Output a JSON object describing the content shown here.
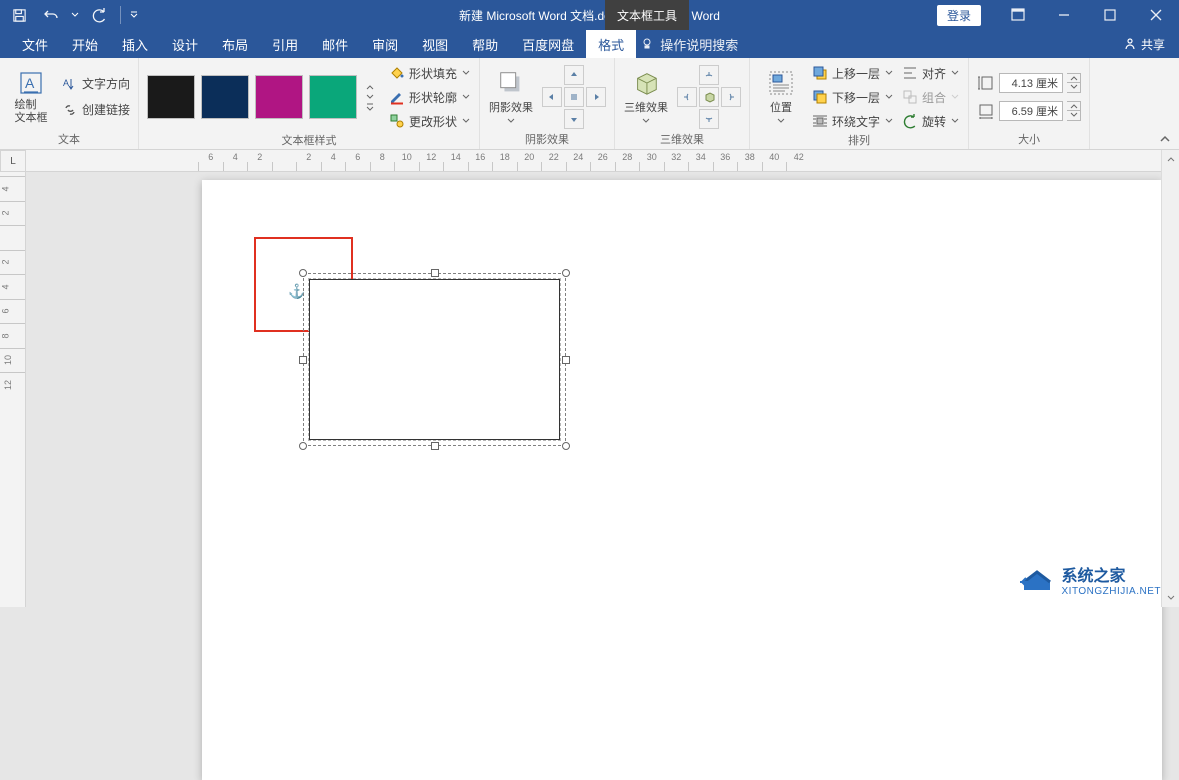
{
  "title": "新建 Microsoft Word 文档.docx [兼容模式] - Word",
  "tool_tab": "文本框工具",
  "login": "登录",
  "tabs": {
    "file": "文件",
    "home": "开始",
    "insert": "插入",
    "design": "设计",
    "layout": "布局",
    "references": "引用",
    "mailings": "邮件",
    "review": "审阅",
    "view": "视图",
    "help": "帮助",
    "baidu": "百度网盘",
    "format": "格式",
    "tell_me": "操作说明搜索",
    "share": "共享"
  },
  "ribbon": {
    "text_group": "文本",
    "draw_textbox": "绘制\n文本框",
    "text_direction": "文字方向",
    "create_link": "创建链接",
    "styles_group": "文本框样式",
    "shape_fill": "形状填充",
    "shape_outline": "形状轮廓",
    "change_shape": "更改形状",
    "shadow_group": "阴影效果",
    "shadow_effect": "阴影效果",
    "threeD_group": "三维效果",
    "threeD_effect": "三维效果",
    "arrange_group": "排列",
    "position": "位置",
    "bring_forward": "上移一层",
    "send_backward": "下移一层",
    "wrap_text": "环绕文字",
    "align": "对齐",
    "group": "组合",
    "rotate": "旋转",
    "size_group": "大小",
    "height": "4.13 厘米",
    "width": "6.59 厘米"
  },
  "swatches": [
    "#1a1a1a",
    "#0b2e59",
    "#b01583",
    "#0aa77a"
  ],
  "h_ruler": [
    "6",
    "4",
    "2",
    "",
    "2",
    "4",
    "6",
    "8",
    "10",
    "12",
    "14",
    "16",
    "18",
    "20",
    "22",
    "24",
    "26",
    "28",
    "30",
    "32",
    "34",
    "36",
    "38",
    "40",
    "42"
  ],
  "v_ruler": [
    "4",
    "2",
    "",
    "2",
    "4",
    "6",
    "8",
    "10",
    "12"
  ],
  "corner": "L",
  "watermark": {
    "title": "系统之家",
    "url": "XITONGZHIJIA.NET"
  }
}
